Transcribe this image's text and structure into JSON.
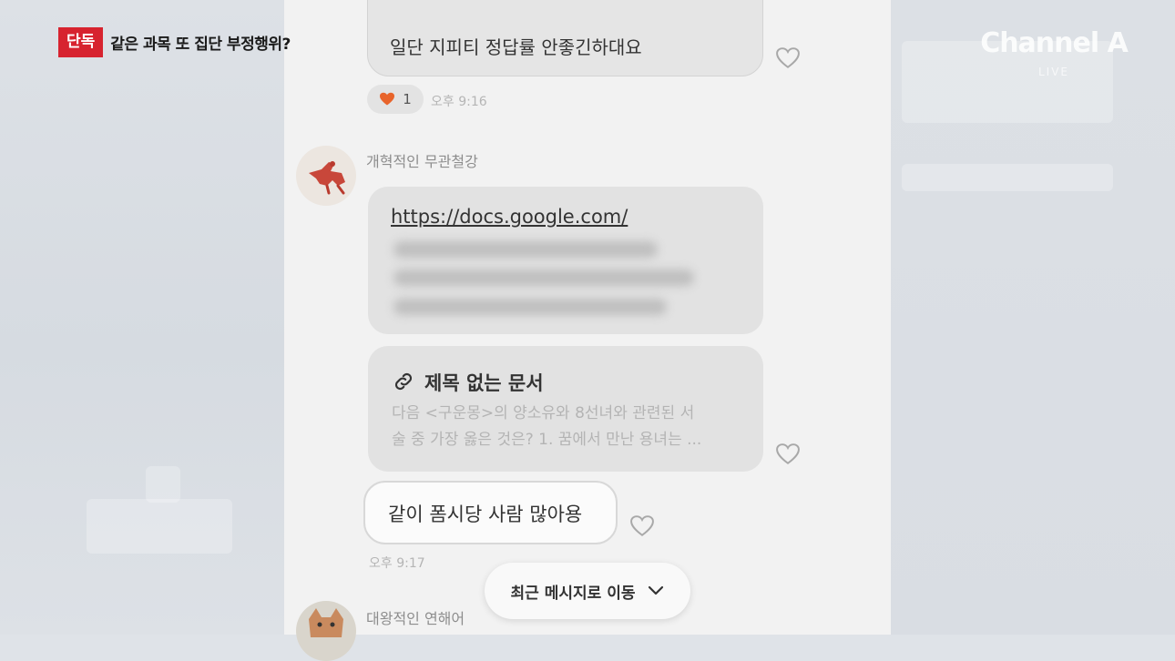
{
  "overlay": {
    "tag": "단독",
    "headline": "같은 과목 또 집단 부정행위?",
    "logo": "Channel A",
    "logo_sub": "LIVE"
  },
  "chat": {
    "msg_top": "일단 지피티 정답률 안좋긴하대요",
    "reaction_count": "1",
    "time_1": "오후 9:16",
    "sender_1": "개혁적인 무관철강",
    "link_url": "https://docs.google.com/",
    "doc_title": "제목 없는 문서",
    "doc_preview": "다음 <구운몽>의 양소유와 8선녀와 관련된 서\n술 중 가장 옳은 것은? 1. 꿈에서 만난 용녀는 ...",
    "msg_out": "같이 폼시당 사람 많아용",
    "time_2": "오후 9:17",
    "jump_label": "최근 메시지로 이동",
    "sender_2": "대왕적인 연해어"
  },
  "colors": {
    "tag_red": "#d7232f",
    "heart_orange": "#e8642b",
    "panel_bg": "#f2f2f2"
  }
}
